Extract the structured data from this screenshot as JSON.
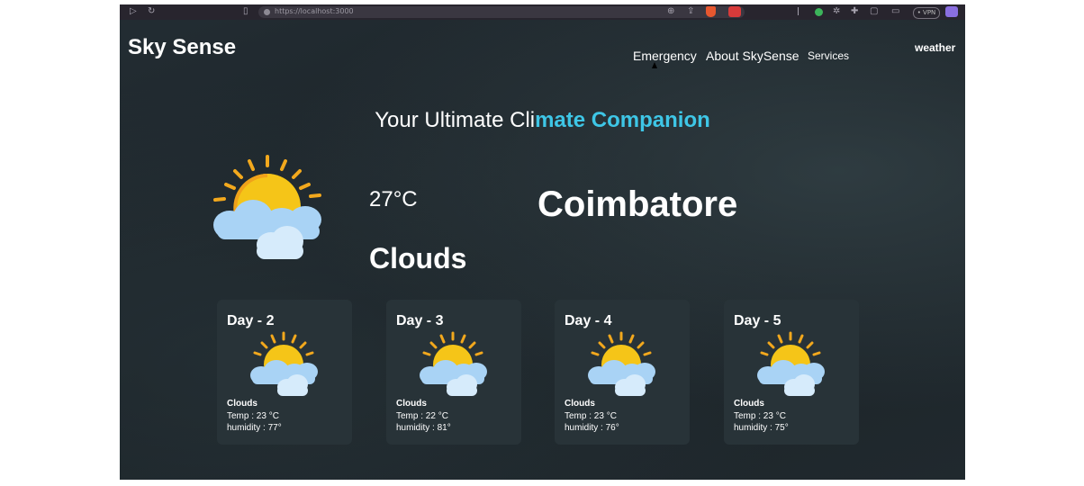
{
  "browser": {
    "url": "https://localhost:3000",
    "vpn_label": "• VPN",
    "icons": [
      "play-icon",
      "reload-icon",
      "bookmark-icon",
      "site-info-icon",
      "zoom-icon",
      "share-icon",
      "brave-shield-icon",
      "extension-icon",
      "mic-icon",
      "extension-green-icon",
      "gear-icon",
      "puzzle-icon",
      "sidebar-icon",
      "wallet-icon",
      "pen-icon"
    ]
  },
  "header": {
    "logo": "Sky Sense",
    "nav": [
      "Emergency",
      "About SkySense",
      "Services"
    ],
    "weather_link": "weather"
  },
  "hero": {
    "part1": "Your Ultimate Cli",
    "part2": "mate Companion"
  },
  "current": {
    "temperature": "27°C",
    "condition": "Clouds",
    "city": "Coimbatore",
    "icon": "partly-cloudy-icon"
  },
  "forecast": [
    {
      "day": "Day - 2",
      "condition": "Clouds",
      "temp": "Temp : 23 °C",
      "humidity": "humidity : 77°"
    },
    {
      "day": "Day - 3",
      "condition": "Clouds",
      "temp": "Temp : 22 °C",
      "humidity": "humidity : 81°"
    },
    {
      "day": "Day - 4",
      "condition": "Clouds",
      "temp": "Temp : 23 °C",
      "humidity": "humidity : 76°"
    },
    {
      "day": "Day - 5",
      "condition": "Clouds",
      "temp": "Temp : 23 °C",
      "humidity": "humidity : 75°"
    }
  ],
  "colors": {
    "background": "#1c2429",
    "card": "#283338",
    "accent": "#3ec6e6",
    "sun": "#f5c518",
    "cloud": "#a9d3f5"
  }
}
